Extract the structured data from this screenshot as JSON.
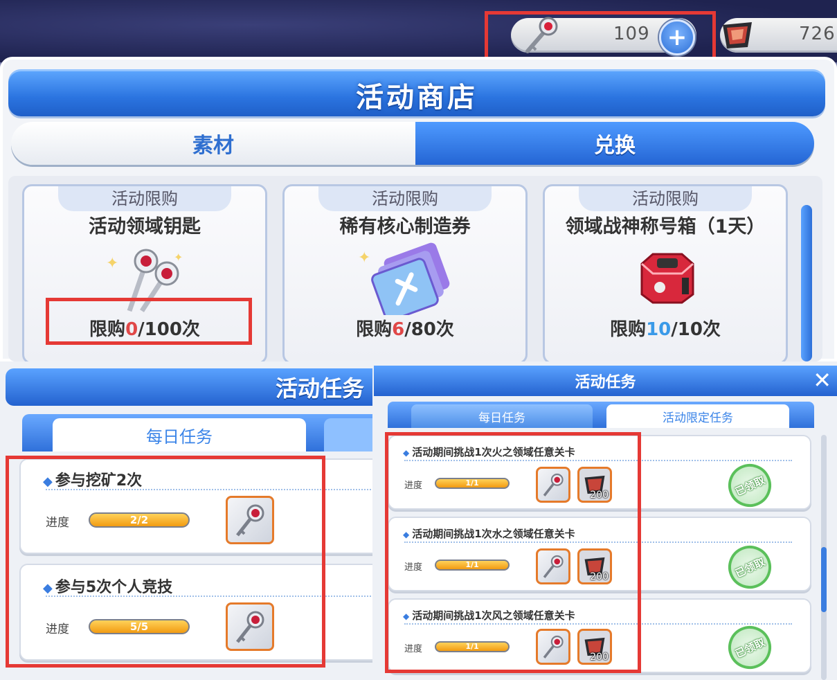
{
  "currency": {
    "key_count": "109",
    "gem_count": "726",
    "add_label": "+"
  },
  "shop": {
    "title": "活动商店",
    "tabs": [
      "素材",
      "兑换"
    ],
    "items": [
      {
        "tag": "活动限购",
        "name": "活动领域钥匙",
        "limit_prefix": "限购",
        "bought": "0",
        "limit_suffix": "/100次",
        "bought_color": "#e04848"
      },
      {
        "tag": "活动限购",
        "name": "稀有核心制造券",
        "limit_prefix": "限购",
        "bought": "6",
        "limit_suffix": "/80次",
        "bought_color": "#e04848"
      },
      {
        "tag": "活动限购",
        "name": "领域战神称号箱（1天）",
        "limit_prefix": "限购",
        "bought": "10",
        "limit_suffix": "/10次",
        "bought_color": "#3a9ae8"
      }
    ]
  },
  "daily_panel": {
    "title": "活动任务",
    "tab": "每日任务",
    "tasks": [
      {
        "name": "参与挖矿2次",
        "progress_label": "进度",
        "progress": "2/2"
      },
      {
        "name": "参与5次个人竞技",
        "progress_label": "进度",
        "progress": "5/5"
      }
    ]
  },
  "event_panel": {
    "title": "活动任务",
    "close": "✕",
    "tabs": [
      "每日任务",
      "活动限定任务"
    ],
    "tasks": [
      {
        "name": "活动期间挑战1次火之领域任意关卡",
        "progress_label": "进度",
        "progress": "1/1",
        "reward_count": "200",
        "status": "已领取"
      },
      {
        "name": "活动期间挑战1次水之领域任意关卡",
        "progress_label": "进度",
        "progress": "1/1",
        "reward_count": "200",
        "status": "已领取"
      },
      {
        "name": "活动期间挑战1次风之领域任意关卡",
        "progress_label": "进度",
        "progress": "1/1",
        "reward_count": "200",
        "status": "已领取"
      }
    ]
  },
  "colors": {
    "accent_blue": "#2b74e0",
    "highlight_red": "#e53935",
    "progress_orange": "#f29b12",
    "claimed_green": "#5bc05b"
  }
}
